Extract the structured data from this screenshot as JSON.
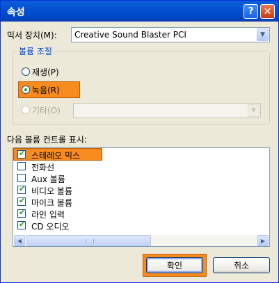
{
  "window": {
    "title": "속성",
    "help_label": "?",
    "close_label": "✕"
  },
  "mixer": {
    "label": "믹서 장치(M):",
    "value": "Creative Sound Blaster PCI",
    "arrow_icon": "chevron-down-icon"
  },
  "volume_group": {
    "title": "볼륨 조절",
    "options": [
      {
        "label": "재생(P)",
        "selected": false,
        "enabled": true
      },
      {
        "label": "녹음(R)",
        "selected": true,
        "enabled": true
      },
      {
        "label": "기타(O)",
        "selected": false,
        "enabled": false
      }
    ],
    "other_value": ""
  },
  "controls": {
    "label": "다음 볼륨 컨트롤 표시:",
    "items": [
      {
        "label": "스테레오 믹스",
        "checked": true
      },
      {
        "label": "전화선",
        "checked": false
      },
      {
        "label": "Aux 볼륨",
        "checked": false
      },
      {
        "label": "비디오 볼륨",
        "checked": true
      },
      {
        "label": "마이크 볼륨",
        "checked": true
      },
      {
        "label": "라인 입력",
        "checked": true
      },
      {
        "label": "CD 오디오",
        "checked": true
      }
    ]
  },
  "buttons": {
    "ok": "확인",
    "cancel": "취소"
  },
  "colors": {
    "highlight": "#f78b1f",
    "titlebar": "#0451d1",
    "check": "#21a121"
  }
}
